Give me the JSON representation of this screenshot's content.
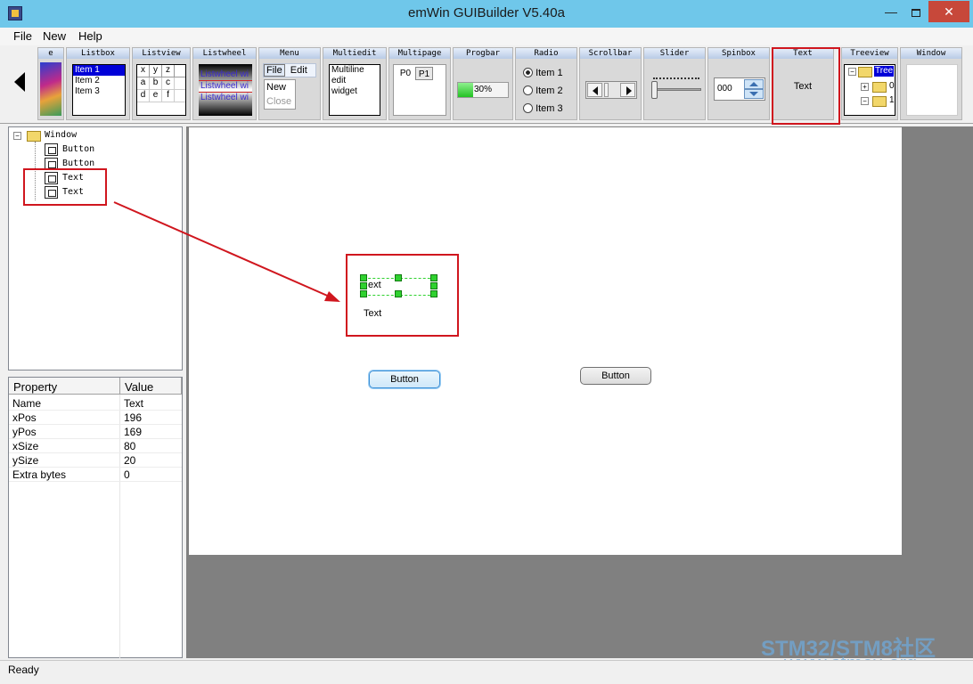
{
  "window": {
    "title": "emWin GUIBuilder V5.40a",
    "min": "—",
    "close": "✕"
  },
  "menu": [
    "File",
    "New",
    "Help"
  ],
  "toolbar": {
    "labels": {
      "image": "e",
      "listbox": "Listbox",
      "listview": "Listview",
      "listwheel": "Listwheel",
      "menu": "Menu",
      "multiedit": "Multiedit",
      "multipage": "Multipage",
      "progbar": "Progbar",
      "radio": "Radio",
      "scrollbar": "Scrollbar",
      "slider": "Slider",
      "spinbox": "Spinbox",
      "text": "Text",
      "treeview": "Treeview",
      "window": "Window"
    },
    "listbox_items": [
      "Item 1",
      "Item 2",
      "Item 3"
    ],
    "listview_cells": [
      "x",
      "y",
      "z",
      "a",
      "b",
      "c",
      "d",
      "e",
      "f"
    ],
    "listwheel_items": [
      "Listwheel wi",
      "Listwheel wi",
      "Listwheel wi"
    ],
    "menu_items": [
      "File",
      "Edit",
      "New",
      "Close"
    ],
    "multiedit_lines": [
      "Multiline",
      "edit",
      "widget"
    ],
    "multipage_tabs": [
      "P0",
      "P1"
    ],
    "progbar_value": "30%",
    "progbar_fraction": 0.3,
    "radio_items": [
      "Item 1",
      "Item 2",
      "Item 3"
    ],
    "spinbox_value": "000",
    "text_sample": "Text",
    "treeview_items": [
      "Tree",
      "0",
      "1"
    ]
  },
  "tree": {
    "root": "Window",
    "children": [
      "Button",
      "Button",
      "Text",
      "Text"
    ]
  },
  "properties": {
    "headers": [
      "Property",
      "Value"
    ],
    "rows": [
      {
        "name": "Name",
        "value": "Text"
      },
      {
        "name": "xPos",
        "value": "196"
      },
      {
        "name": "yPos",
        "value": "169"
      },
      {
        "name": "xSize",
        "value": "80"
      },
      {
        "name": "ySize",
        "value": "20"
      },
      {
        "name": "Extra bytes",
        "value": "0"
      }
    ]
  },
  "canvas": {
    "selected_text": "ext",
    "text2": "Text",
    "button1": "Button",
    "button2": "Button"
  },
  "status": "Ready",
  "watermark": {
    "line1": "STM32/STM8社区",
    "line2": "www.stmcu.org"
  }
}
